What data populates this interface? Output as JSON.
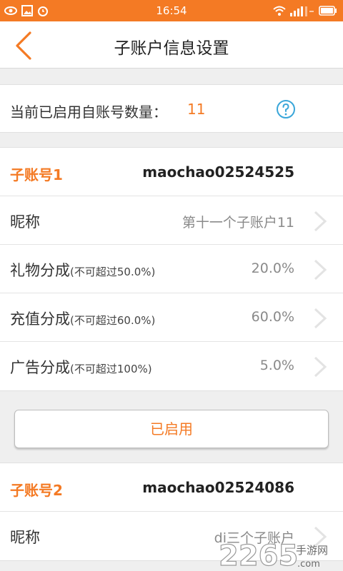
{
  "status_bar": {
    "time": "16:54",
    "left_icons": [
      "eye-icon",
      "image-icon",
      "alarm-icon"
    ],
    "right_icons": [
      "wifi-icon",
      "signal-icon",
      "battery-icon"
    ]
  },
  "header": {
    "title": "子账户信息设置",
    "back_icon": "back-chevron-icon"
  },
  "summary": {
    "label": "当前已启用自账号数量：",
    "count": "11",
    "help_icon": "question-circle-icon"
  },
  "accounts": [
    {
      "name": "子账号1",
      "id": "maochao02524525",
      "rows": [
        {
          "label": "昵称",
          "hint": "",
          "value": "第十一个子账户11"
        },
        {
          "label": "礼物分成",
          "hint": "(不可超过50.0%)",
          "value": "20.0%"
        },
        {
          "label": "充值分成",
          "hint": "(不可超过60.0%)",
          "value": "60.0%"
        },
        {
          "label": "广告分成",
          "hint": "(不可超过100%)",
          "value": "5.0%"
        }
      ],
      "button_label": "已启用"
    },
    {
      "name": "子账号2",
      "id": "maochao02524086",
      "rows": [
        {
          "label": "昵称",
          "hint": "",
          "value": "di三个子账户"
        }
      ]
    }
  ],
  "watermark": {
    "text": "2265",
    "suffix": "手游网",
    "url": ".com"
  },
  "colors": {
    "accent": "#f47a24",
    "background": "#efefef",
    "text": "#333333",
    "muted": "#8a8a8a"
  }
}
